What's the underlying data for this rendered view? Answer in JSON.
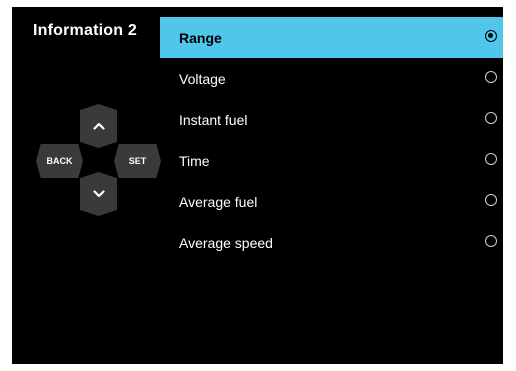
{
  "screen": {
    "title": "Information 2"
  },
  "dpad": {
    "up_icon": "chevron-up-icon",
    "down_icon": "chevron-down-icon",
    "back_label": "BACK",
    "set_label": "SET"
  },
  "menu": {
    "items": [
      {
        "label": "Range",
        "selected": true
      },
      {
        "label": "Voltage",
        "selected": false
      },
      {
        "label": "Instant fuel",
        "selected": false
      },
      {
        "label": "Time",
        "selected": false
      },
      {
        "label": "Average fuel",
        "selected": false
      },
      {
        "label": "Average speed",
        "selected": false
      }
    ]
  },
  "colors": {
    "background": "#000000",
    "highlight": "#4fc6ea",
    "dpad": "#3a3a3a",
    "text": "#ffffff"
  }
}
